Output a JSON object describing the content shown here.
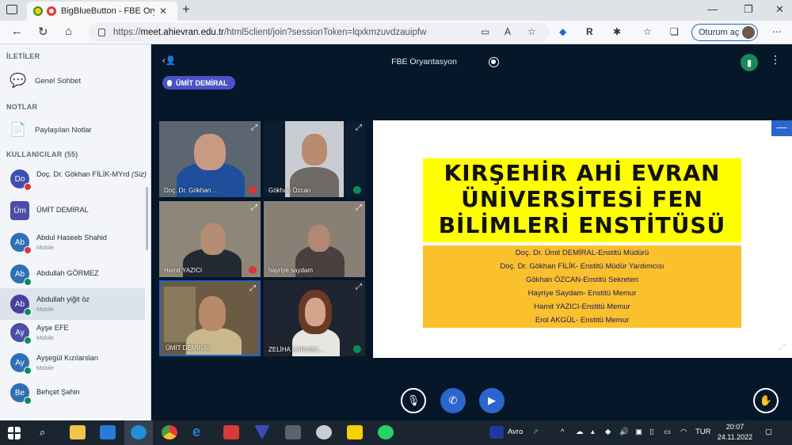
{
  "browser": {
    "tab_title": "BigBlueButton - FBE Oryantasyon",
    "url_prefix": "https://",
    "url_host": "meet.ahievran.edu.tr",
    "url_path": "/html5client/join?sessionToken=lqxkmzuvdzauipfw",
    "tab_close": "✕",
    "new_tab": "+",
    "signin_label": "Oturum aç",
    "reader_label": "R"
  },
  "sidebar": {
    "messages_title": "İLETİLER",
    "public_chat": "Genel Sohbet",
    "notes_title": "NOTLAR",
    "shared_notes": "Paylaşılan Notlar",
    "users_title": "KULLANICILAR (55)",
    "users": [
      {
        "initials": "Do",
        "name": "Doç. Dr. Gökhan FİLİK-MYrd",
        "you": "(Siz)",
        "sub": "",
        "status": "red",
        "color": "#3f4fb0"
      },
      {
        "initials": "Üm",
        "name": "ÜMİT DEMİRAL",
        "you": "",
        "sub": "",
        "status": "none",
        "color": "#4a4ea8"
      },
      {
        "initials": "Ab",
        "name": "Abdul Haseeb Shahid",
        "you": "",
        "sub": "Mobile",
        "status": "red",
        "color": "#2f6fb5"
      },
      {
        "initials": "Ab",
        "name": "Abdullah GÖRMEZ",
        "you": "",
        "sub": "",
        "status": "green",
        "color": "#2f6fb5"
      },
      {
        "initials": "Ab",
        "name": "Abdullah yiğit öz",
        "you": "",
        "sub": "Mobile",
        "status": "green",
        "color": "#4a3f9e"
      },
      {
        "initials": "Ay",
        "name": "Ayşe EFE",
        "you": "",
        "sub": "Mobile",
        "status": "green",
        "color": "#4a4ea8"
      },
      {
        "initials": "Ay",
        "name": "Ayşegül Kızılarslan",
        "you": "",
        "sub": "Mobile",
        "status": "green",
        "color": "#2f6fb5"
      },
      {
        "initials": "Be",
        "name": "Behçet Şahin",
        "you": "",
        "sub": "",
        "status": "green",
        "color": "#2f6fb5"
      }
    ]
  },
  "meeting": {
    "title": "FBE Oryantasyon",
    "talker": "ÜMİT DEMİRAL",
    "tiles": [
      {
        "name": "Doç. Dr. Gökhan ...",
        "status": "red"
      },
      {
        "name": "Gökhan Özcan",
        "status": "green"
      },
      {
        "name": "Hamit YAZICI",
        "status": "red"
      },
      {
        "name": "hayriye saydam",
        "status": "none"
      },
      {
        "name": "ÜMİT DEMİRAL",
        "status": "none"
      },
      {
        "name": "ZELİHA KARABU...",
        "status": "green"
      }
    ]
  },
  "slide": {
    "title_lines": [
      "KIRŞEHİR AHİ EVRAN",
      "ÜNİVERSİTESİ FEN",
      "BİLİMLERİ ENSTİTÜSÜ"
    ],
    "staff": [
      "Doç. Dr. Ümit DEMİRAL-Enstitü Müdürü",
      "Doç. Dr. Gökhan FİLİK- Enstitü Müdür Yardımcısı",
      "Gökhan ÖZCAN-Enstitü Sekreteri",
      "Hayriye Saydam- Enstitü Memur",
      "Hamit YAZICI-Enstitü Memur",
      "Erol AKGÜL- Enstitü Memur"
    ]
  },
  "taskbar": {
    "weather": "Avro",
    "lang": "TUR",
    "time": "20:07",
    "date": "24.11.2022"
  },
  "colors": {
    "accent": "#2a66cc",
    "talker": "#4b53c7",
    "muted": "#d9363e",
    "listen": "#0d8a5a"
  }
}
